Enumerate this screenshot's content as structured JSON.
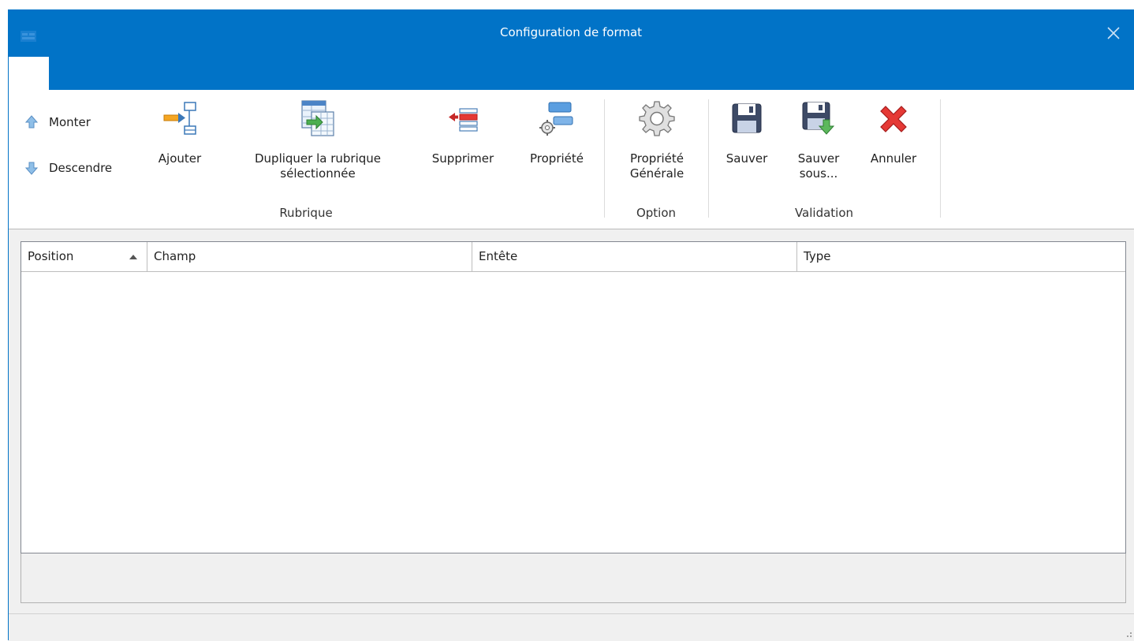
{
  "window": {
    "title": "Configuration de format",
    "app_icon": "app-icon",
    "close_icon": "close-icon",
    "accent_color": "#0173c7"
  },
  "ribbon": {
    "small_buttons": [
      {
        "label": "Monter",
        "icon": "arrow-up-icon"
      },
      {
        "label": "Descendre",
        "icon": "arrow-down-icon"
      }
    ],
    "groups": [
      {
        "label": "Rubrique",
        "buttons": [
          {
            "label": "Ajouter",
            "icon": "add-field-icon"
          },
          {
            "label_line1": "Dupliquer la rubrique",
            "label_line2": "sélectionnée",
            "icon": "duplicate-field-icon"
          },
          {
            "label": "Supprimer",
            "icon": "delete-field-icon"
          },
          {
            "label": "Propriété",
            "icon": "field-properties-icon"
          }
        ]
      },
      {
        "label": "Option",
        "buttons": [
          {
            "label_line1": "Propriété",
            "label_line2": "Générale",
            "icon": "gear-icon"
          }
        ]
      },
      {
        "label": "Validation",
        "buttons": [
          {
            "label": "Sauver",
            "icon": "save-icon"
          },
          {
            "label_line1": "Sauver",
            "label_line2": "sous...",
            "icon": "save-as-icon"
          },
          {
            "label": "Annuler",
            "icon": "cancel-icon"
          }
        ]
      }
    ]
  },
  "grid": {
    "columns": [
      "Position",
      "Champ",
      "Entête",
      "Type"
    ],
    "sort_column": "Position",
    "sort_direction": "ascending",
    "rows": []
  }
}
